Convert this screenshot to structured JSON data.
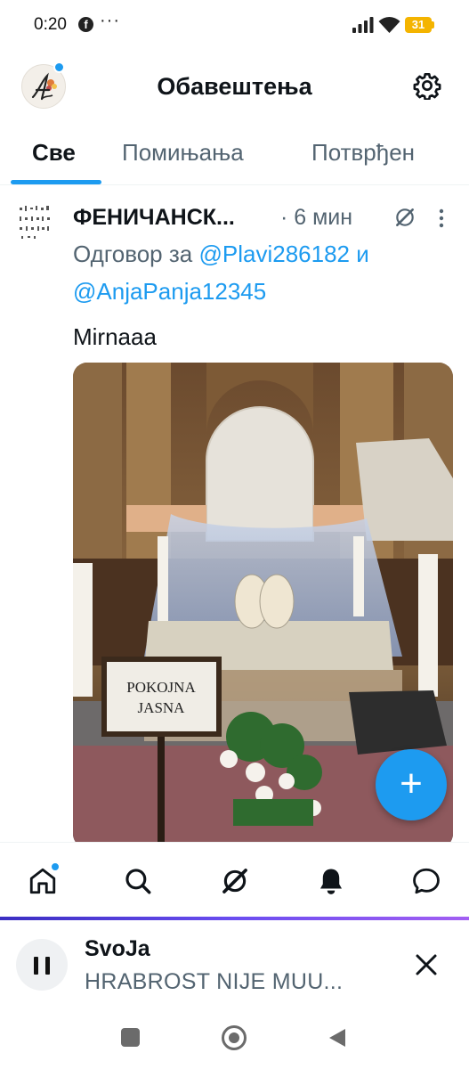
{
  "status_bar": {
    "time": "0:20",
    "notification_icons": [
      "facebook-icon",
      "more-dots"
    ],
    "dots": "···",
    "battery": "31",
    "battery_color": "#f4b400"
  },
  "header": {
    "title": "Обавештења",
    "avatar_icon": "profile-avatar",
    "settings_icon": "gear-icon"
  },
  "tabs": [
    {
      "label": "Све",
      "active": true
    },
    {
      "label": "Помињања",
      "active": false
    },
    {
      "label": "Потврђен",
      "active": false
    }
  ],
  "post": {
    "author": "ФЕНИЧАНСК...",
    "time": "· 6 мин",
    "reply_prefix": "Одговор за",
    "mention_1": "@Plavi286182",
    "conjunction": "и",
    "mention_2": "@AnjaPanja12345",
    "text": "Mirnaaa",
    "image_sign": "POKOJNA\nJASNA",
    "image_sign_line1": "POKOJNA",
    "image_sign_line2": "JASNA"
  },
  "fab": {
    "label": "+",
    "color": "#1d9bf0"
  },
  "bottom_nav": [
    {
      "name": "home",
      "icon": "home-icon",
      "has_dot": true
    },
    {
      "name": "search",
      "icon": "search-icon"
    },
    {
      "name": "grok",
      "icon": "grok-icon"
    },
    {
      "name": "notifications",
      "icon": "bell-icon",
      "active": true
    },
    {
      "name": "messages",
      "icon": "message-icon"
    }
  ],
  "player": {
    "title": "SvoJa",
    "subtitle": "HRABROST NIJE MUU...",
    "state_icon": "pause-icon"
  },
  "accent_color": "#1d9bf0"
}
